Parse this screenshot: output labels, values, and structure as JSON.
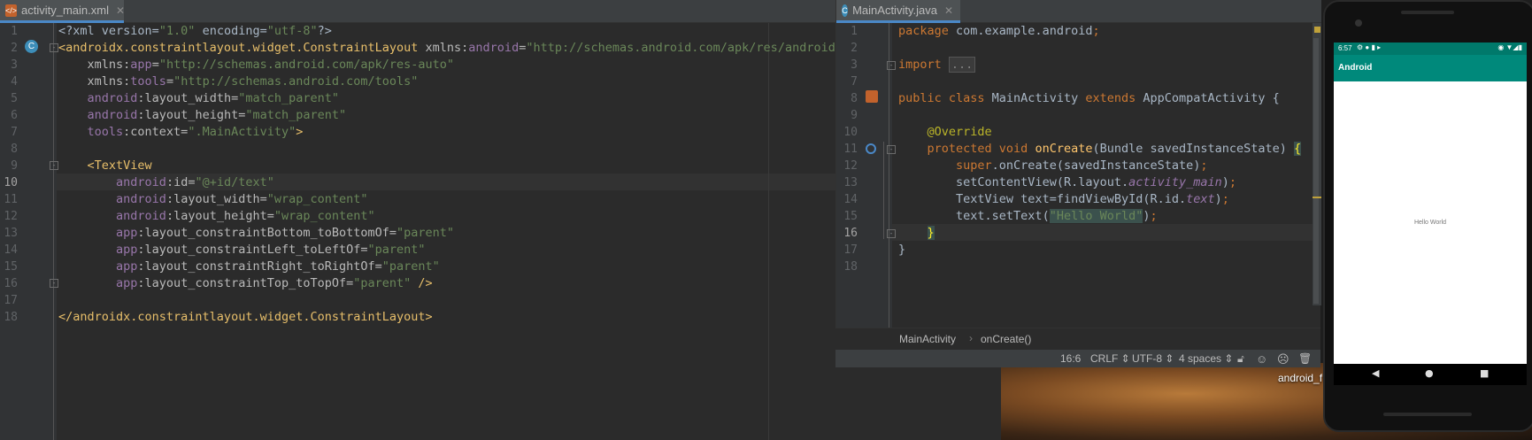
{
  "left_editor": {
    "tab_label": "activity_main.xml",
    "tab_icon": "xml-file-icon",
    "current_line": 10,
    "lines": [
      {
        "n": "1",
        "html": "<span class='t-plain'>&lt;?xml version=</span><span class='t-str'>\"1.0\"</span><span class='t-plain'> encoding=</span><span class='t-str'>\"utf-8\"</span><span class='t-plain'>?&gt;</span>"
      },
      {
        "n": "2",
        "html": "<span class='t-tag'>&lt;androidx.constraintlayout.widget.ConstraintLayout </span><span class='t-attr'>xmlns:</span><span class='t-ns'>android</span><span class='t-attr'>=</span><span class='t-str'>\"http://schemas.android.com/apk/res/android\"</span>"
      },
      {
        "n": "3",
        "html": "    <span class='t-attr'>xmlns:</span><span class='t-ns'>app</span><span class='t-attr'>=</span><span class='t-str'>\"http://schemas.android.com/apk/res-auto\"</span>"
      },
      {
        "n": "4",
        "html": "    <span class='t-attr'>xmlns:</span><span class='t-ns'>tools</span><span class='t-attr'>=</span><span class='t-str'>\"http://schemas.android.com/tools\"</span>"
      },
      {
        "n": "5",
        "html": "    <span class='t-ns'>android</span><span class='t-attr'>:layout_width=</span><span class='t-str'>\"match_parent\"</span>"
      },
      {
        "n": "6",
        "html": "    <span class='t-ns'>android</span><span class='t-attr'>:layout_height=</span><span class='t-str'>\"match_parent\"</span>"
      },
      {
        "n": "7",
        "html": "    <span class='t-ns'>tools</span><span class='t-attr'>:context=</span><span class='t-str'>\".MainActivity\"</span><span class='t-tag'>&gt;</span>"
      },
      {
        "n": "8",
        "html": ""
      },
      {
        "n": "9",
        "html": "    <span class='t-tag'>&lt;TextView</span>"
      },
      {
        "n": "10",
        "html": "        <span class='t-ns'>android</span><span class='t-attr'>:id=</span><span class='t-str'>\"@+id/text\"</span>"
      },
      {
        "n": "11",
        "html": "        <span class='t-ns'>android</span><span class='t-attr'>:layout_width=</span><span class='t-str'>\"wrap_content\"</span>"
      },
      {
        "n": "12",
        "html": "        <span class='t-ns'>android</span><span class='t-attr'>:layout_height=</span><span class='t-str'>\"wrap_content\"</span>"
      },
      {
        "n": "13",
        "html": "        <span class='t-ns'>app</span><span class='t-attr'>:layout_constraintBottom_toBottomOf=</span><span class='t-str'>\"parent\"</span>"
      },
      {
        "n": "14",
        "html": "        <span class='t-ns'>app</span><span class='t-attr'>:layout_constraintLeft_toLeftOf=</span><span class='t-str'>\"parent\"</span>"
      },
      {
        "n": "15",
        "html": "        <span class='t-ns'>app</span><span class='t-attr'>:layout_constraintRight_toRightOf=</span><span class='t-str'>\"parent\"</span>"
      },
      {
        "n": "16",
        "html": "        <span class='t-ns'>app</span><span class='t-attr'>:layout_constraintTop_toTopOf=</span><span class='t-str'>\"parent\"</span><span class='t-tag'> /&gt;</span>"
      },
      {
        "n": "17",
        "html": ""
      },
      {
        "n": "18",
        "html": "<span class='t-tag'>&lt;/androidx.constraintlayout.widget.ConstraintLayout&gt;</span>"
      }
    ]
  },
  "right_editor": {
    "tab_label": "MainActivity.java",
    "tab_icon": "java-class-icon",
    "current_line": 16,
    "lines": [
      {
        "n": "1",
        "html": "<span class='t-kw'>package </span><span class='t-plain'>com.example.android</span><span class='t-kw'>;</span>"
      },
      {
        "n": "2",
        "html": ""
      },
      {
        "n": "3",
        "html": "<span class='t-kw'>import </span><span class='t-fold'>...</span>"
      },
      {
        "n": "7",
        "html": ""
      },
      {
        "n": "8",
        "html": "<span class='t-kw'>public class </span><span class='t-plain'>MainActivity </span><span class='t-kw'>extends </span><span class='t-plain'>AppCompatActivity {</span>"
      },
      {
        "n": "9",
        "html": ""
      },
      {
        "n": "10",
        "html": "    <span class='t-ann'>@Override</span>"
      },
      {
        "n": "11",
        "html": "    <span class='t-kw'>protected void </span><span class='t-fn'>onCreate</span><span class='t-plain'>(Bundle savedInstanceState) </span><span class='t-br'>{</span>"
      },
      {
        "n": "12",
        "html": "        <span class='t-kw'>super</span><span class='t-plain'>.onCreate(savedInstanceState)</span><span class='t-kw'>;</span>"
      },
      {
        "n": "13",
        "html": "        <span class='t-plain'>setContentView(R.layout.</span><span class='t-it'>activity_main</span><span class='t-plain'>)</span><span class='t-kw'>;</span>"
      },
      {
        "n": "14",
        "html": "        <span class='t-plain'>TextView text=findViewById(R.id.</span><span class='t-it'>text</span><span class='t-plain'>)</span><span class='t-kw'>;</span>"
      },
      {
        "n": "15",
        "html": "        <span class='t-plain'>text.setText(</span><span class='t-str t-hl'>\"Hello World\"</span><span class='t-plain'>)</span><span class='t-kw'>;</span>"
      },
      {
        "n": "16",
        "html": "    <span class='t-br'>}</span>"
      },
      {
        "n": "17",
        "html": "<span class='t-plain'>}</span>"
      },
      {
        "n": "18",
        "html": ""
      }
    ],
    "breadcrumb": [
      "MainActivity",
      "onCreate()"
    ],
    "status": {
      "position": "16:6",
      "line_sep": "CRLF",
      "encoding": "UTF-8",
      "indent": "4 spaces"
    }
  },
  "desktop": {
    "label": "android_f"
  },
  "phone": {
    "time": "6:57",
    "app_title": "Android",
    "content_text": "Hello World",
    "nav_back": "◀",
    "nav_home": "●",
    "nav_recent": "■"
  }
}
